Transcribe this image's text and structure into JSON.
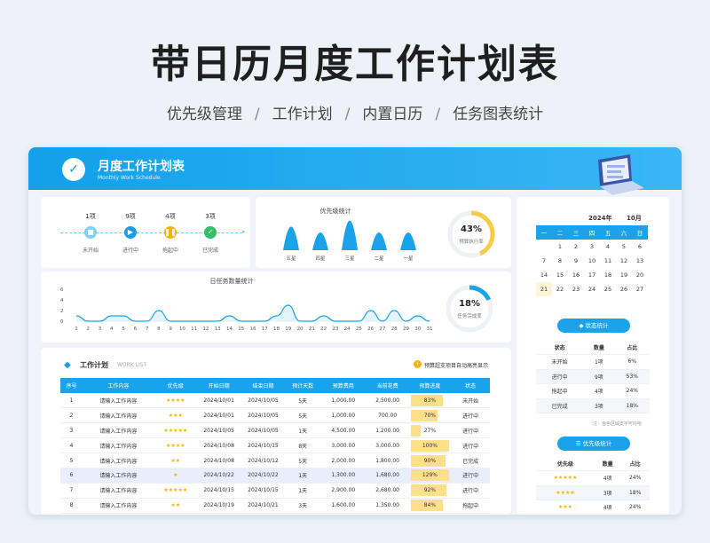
{
  "poster": {
    "title": "带日历月度工作计划表",
    "features": [
      "优先级管理",
      "工作计划",
      "内置日历",
      "任务图表统计"
    ],
    "separator": "/"
  },
  "banner": {
    "title": "月度工作计划表",
    "subtitle": "Monthly Work Schedule",
    "logo_glyph": "✓"
  },
  "flow": [
    {
      "count": "1项",
      "label": "未开始",
      "color": "#7fd0f5",
      "icon": "square-icon"
    },
    {
      "count": "9项",
      "label": "进行中",
      "color": "#1a9de6",
      "icon": "play-icon"
    },
    {
      "count": "4项",
      "label": "拖起中",
      "color": "#f5b400",
      "icon": "pause-icon"
    },
    {
      "count": "3项",
      "label": "已完成",
      "color": "#34c06a",
      "icon": "check-icon"
    }
  ],
  "priority_chart": {
    "title": "优先级统计",
    "categories": [
      "五星",
      "四星",
      "三星",
      "二星",
      "一星"
    ],
    "values": [
      4,
      3,
      5,
      3,
      3
    ],
    "donut_pct": "43%",
    "donut_label": "预算执行率",
    "donut_value": 0.43,
    "donut_color": "#f7cd48"
  },
  "chart_data": {
    "type": "area",
    "title": "日任务数量统计",
    "x": [
      1,
      2,
      3,
      4,
      5,
      6,
      7,
      8,
      9,
      10,
      11,
      12,
      13,
      14,
      15,
      16,
      17,
      18,
      19,
      20,
      21,
      22,
      23,
      24,
      25,
      26,
      27,
      28,
      29,
      30,
      31
    ],
    "values": [
      1,
      0,
      0,
      1,
      1,
      0,
      0,
      2,
      0,
      0,
      0,
      0,
      0,
      1,
      0,
      0,
      0,
      1,
      3,
      0,
      0,
      1,
      0,
      0,
      0,
      2,
      0,
      2,
      0,
      1,
      0
    ],
    "yticks": [
      0,
      2,
      4,
      6
    ],
    "ylim": [
      0,
      6
    ]
  },
  "daily_donut": {
    "pct": "18%",
    "label": "任务完成率",
    "value": 0.18,
    "color": "#1aa3ea"
  },
  "worklist": {
    "title": "工作计划",
    "subtitle": "WORK LIST",
    "note": "预算超支项目自动高亮显示",
    "headers": [
      "序号",
      "工作内容",
      "优先级",
      "开始日期",
      "结束日期",
      "预计天数",
      "预算费用",
      "当前花费",
      "预算进度",
      "状态"
    ],
    "rows": [
      {
        "no": "1",
        "content": "请输入工作内容",
        "stars": "★★★★",
        "start": "2024/10/01",
        "end": "2024/10/05",
        "days": "5天",
        "budget": "1,000.00",
        "spent": "2,500.00",
        "progress": "83%",
        "pv": 0.83,
        "status": "未开始"
      },
      {
        "no": "2",
        "content": "请输入工作内容",
        "stars": "★★★",
        "start": "2024/10/01",
        "end": "2024/10/05",
        "days": "5天",
        "budget": "1,000.00",
        "spent": "700.00",
        "progress": "70%",
        "pv": 0.7,
        "status": "进行中"
      },
      {
        "no": "3",
        "content": "请输入工作内容",
        "stars": "★★★★★",
        "start": "2024/10/05",
        "end": "2024/10/05",
        "days": "1天",
        "budget": "4,500.00",
        "spent": "1,200.00",
        "progress": "27%",
        "pv": 0.27,
        "status": "进行中"
      },
      {
        "no": "4",
        "content": "请输入工作内容",
        "stars": "★★★★",
        "start": "2024/10/08",
        "end": "2024/10/15",
        "days": "8天",
        "budget": "3,000.00",
        "spent": "3,000.00",
        "progress": "100%",
        "pv": 1.0,
        "status": "进行中"
      },
      {
        "no": "5",
        "content": "请输入工作内容",
        "stars": "★★",
        "start": "2024/10/08",
        "end": "2024/10/12",
        "days": "5天",
        "budget": "2,000.00",
        "spent": "1,800.00",
        "progress": "90%",
        "pv": 0.9,
        "status": "已完成"
      },
      {
        "no": "6",
        "content": "请输入工作内容",
        "stars": "★",
        "start": "2024/10/22",
        "end": "2024/10/22",
        "days": "1天",
        "budget": "1,300.00",
        "spent": "1,680.00",
        "progress": "129%",
        "pv": 1.0,
        "status": "进行中"
      },
      {
        "no": "7",
        "content": "请输入工作内容",
        "stars": "★★★★★",
        "start": "2024/10/15",
        "end": "2024/10/15",
        "days": "1天",
        "budget": "2,900.00",
        "spent": "2,680.00",
        "progress": "92%",
        "pv": 0.92,
        "status": "进行中"
      },
      {
        "no": "8",
        "content": "请输入工作内容",
        "stars": "★★",
        "start": "2024/10/19",
        "end": "2024/10/21",
        "days": "3天",
        "budget": "1,600.00",
        "spent": "1,350.00",
        "progress": "84%",
        "pv": 0.84,
        "status": "拖起中"
      }
    ],
    "highlight_row": 5
  },
  "calendar": {
    "year": "2024年",
    "month": "10月",
    "weekdays": [
      "一",
      "二",
      "三",
      "四",
      "五",
      "六",
      "日"
    ],
    "weeks": [
      [
        "",
        "1",
        "2",
        "3",
        "4",
        "5",
        "6"
      ],
      [
        "7",
        "8",
        "9",
        "10",
        "11",
        "12",
        "13"
      ],
      [
        "14",
        "15",
        "16",
        "17",
        "18",
        "19",
        "20"
      ],
      [
        "21",
        "22",
        "23",
        "24",
        "25",
        "26",
        "27"
      ]
    ],
    "today": "21"
  },
  "status_stats": {
    "title": "状态统计",
    "headers": [
      "状态",
      "数量",
      "占比"
    ],
    "rows": [
      [
        "未开始",
        "1项",
        "6%"
      ],
      [
        "进行中",
        "9项",
        "53%"
      ],
      [
        "拖起中",
        "4项",
        "24%"
      ],
      [
        "已完成",
        "3项",
        "18%"
      ]
    ],
    "note": "注：自色区域支字可吟哈"
  },
  "priority_stats": {
    "title": "优先级统计",
    "headers": [
      "优先级",
      "数量",
      "占比"
    ],
    "rows": [
      [
        "★★★★★",
        "4项",
        "24%"
      ],
      [
        "★★★★",
        "3项",
        "18%"
      ],
      [
        "★★★",
        "4项",
        "24%"
      ]
    ]
  },
  "colors": {
    "accent": "#1aa3ea",
    "gold": "#f5b400",
    "progress": "#ffe08a"
  }
}
